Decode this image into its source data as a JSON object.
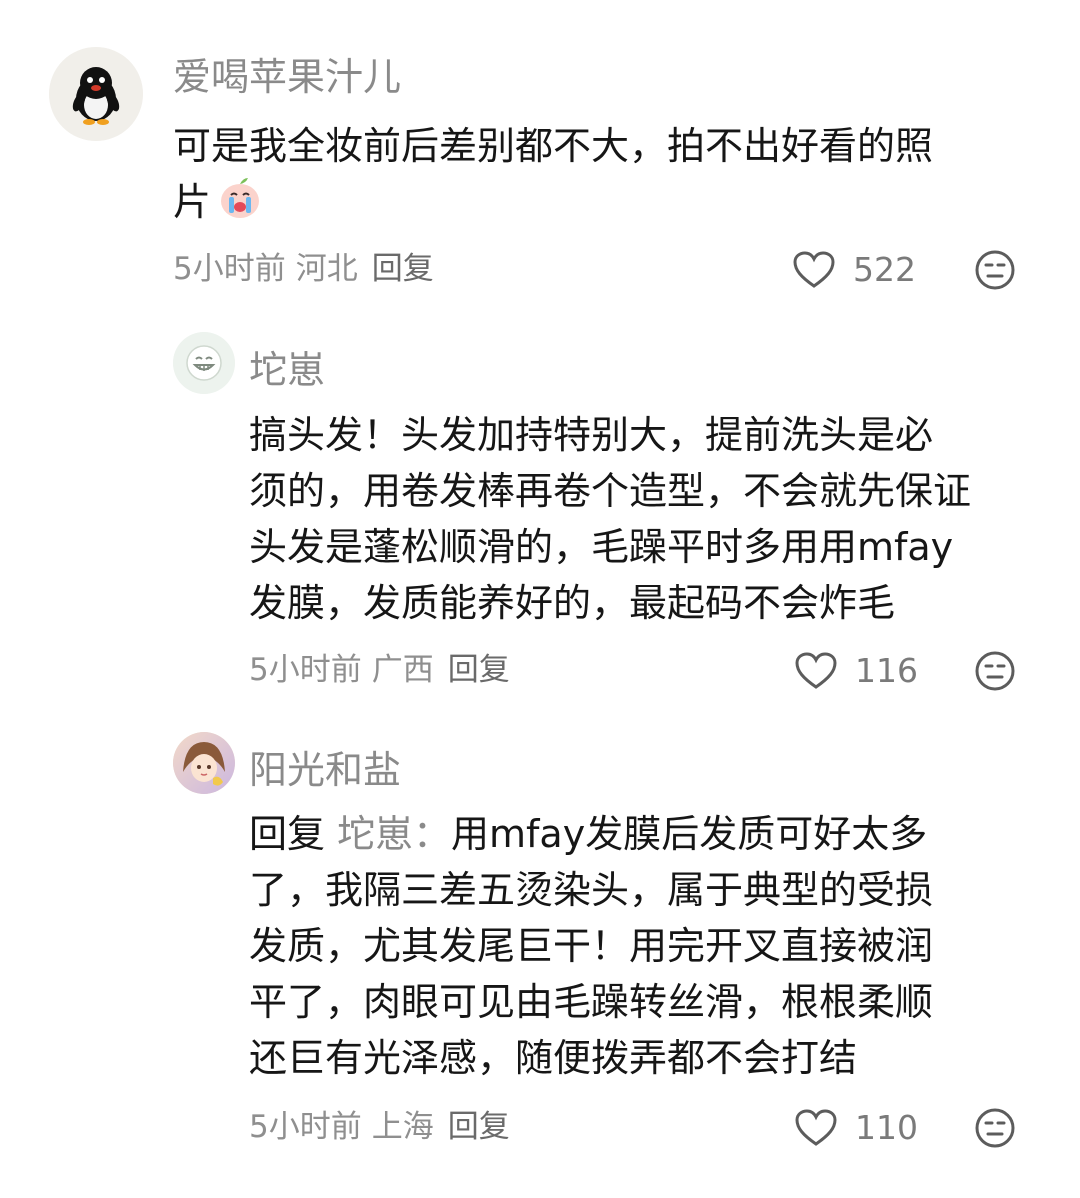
{
  "comments": [
    {
      "username": "爱喝苹果汁儿",
      "avatar_icon": "penguin-avatar",
      "lines": [
        "可是我全妆前后差别都不大，拍不出好看的照",
        "片"
      ],
      "emoji_icon": "crying-peach-emoji",
      "time": "5小时前",
      "location": "河北",
      "reply_label": "回复",
      "likes": "522"
    },
    {
      "username": "坨崽",
      "avatar_icon": "smiley-face-avatar",
      "lines": [
        "搞头发！头发加持特别大，提前洗头是必",
        "须的，用卷发棒再卷个造型，不会就先保证",
        "头发是蓬松顺滑的，毛躁平时多用用mfay",
        "发膜，发质能养好的，最起码不会炸毛"
      ],
      "time": "5小时前",
      "location": "广西",
      "reply_label": "回复",
      "likes": "116"
    },
    {
      "username": "阳光和盐",
      "avatar_icon": "anime-girl-avatar",
      "reply_prefix": "回复",
      "reply_target": "坨崽：",
      "first_line_rest": "用mfay发膜后发质可好太多",
      "lines": [
        "了，我隔三差五烫染头，属于典型的受损",
        "发质，尤其发尾巨干！用完开叉直接被润",
        "平了，肉眼可见由毛躁转丝滑，根根柔顺",
        "还巨有光泽感，随便拨弄都不会打结"
      ],
      "time": "5小时前",
      "location": "上海",
      "reply_label": "回复",
      "likes": "110"
    }
  ]
}
